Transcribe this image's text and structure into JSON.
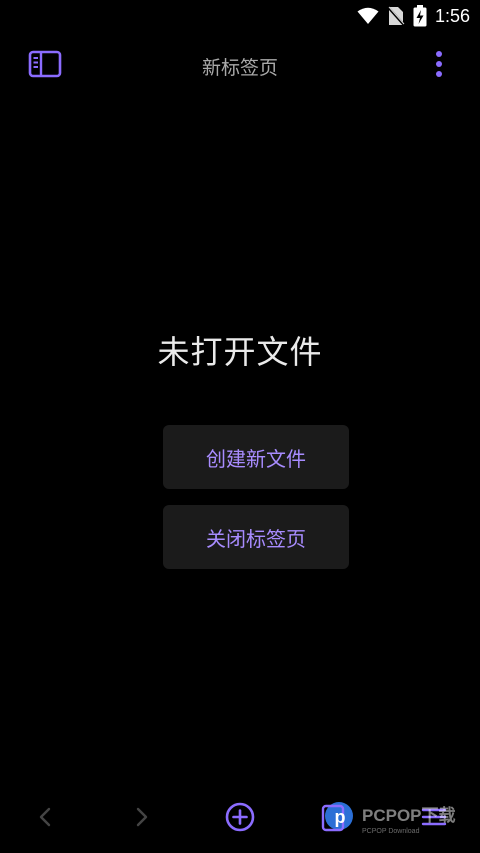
{
  "status_bar": {
    "time": "1:56",
    "icons": [
      "wifi-icon",
      "no-sim-icon",
      "battery-charging-icon"
    ]
  },
  "header": {
    "title": "新标签页",
    "left_icon": "sidebar-toggle-icon",
    "right_icon": "more-vertical-icon"
  },
  "empty_state": {
    "message": "未打开文件",
    "create_label": "创建新文件",
    "close_label": "关闭标签页"
  },
  "bottom_bar": {
    "items": [
      "back-icon",
      "forward-icon",
      "add-icon",
      "app-logo-icon",
      "menu-icon"
    ]
  },
  "watermark": {
    "brand": "PCPOP下载",
    "sub": "PCPOP Download"
  },
  "colors": {
    "accent": "#8b6cff",
    "button_bg": "#1b1b1b",
    "background": "#000000"
  }
}
